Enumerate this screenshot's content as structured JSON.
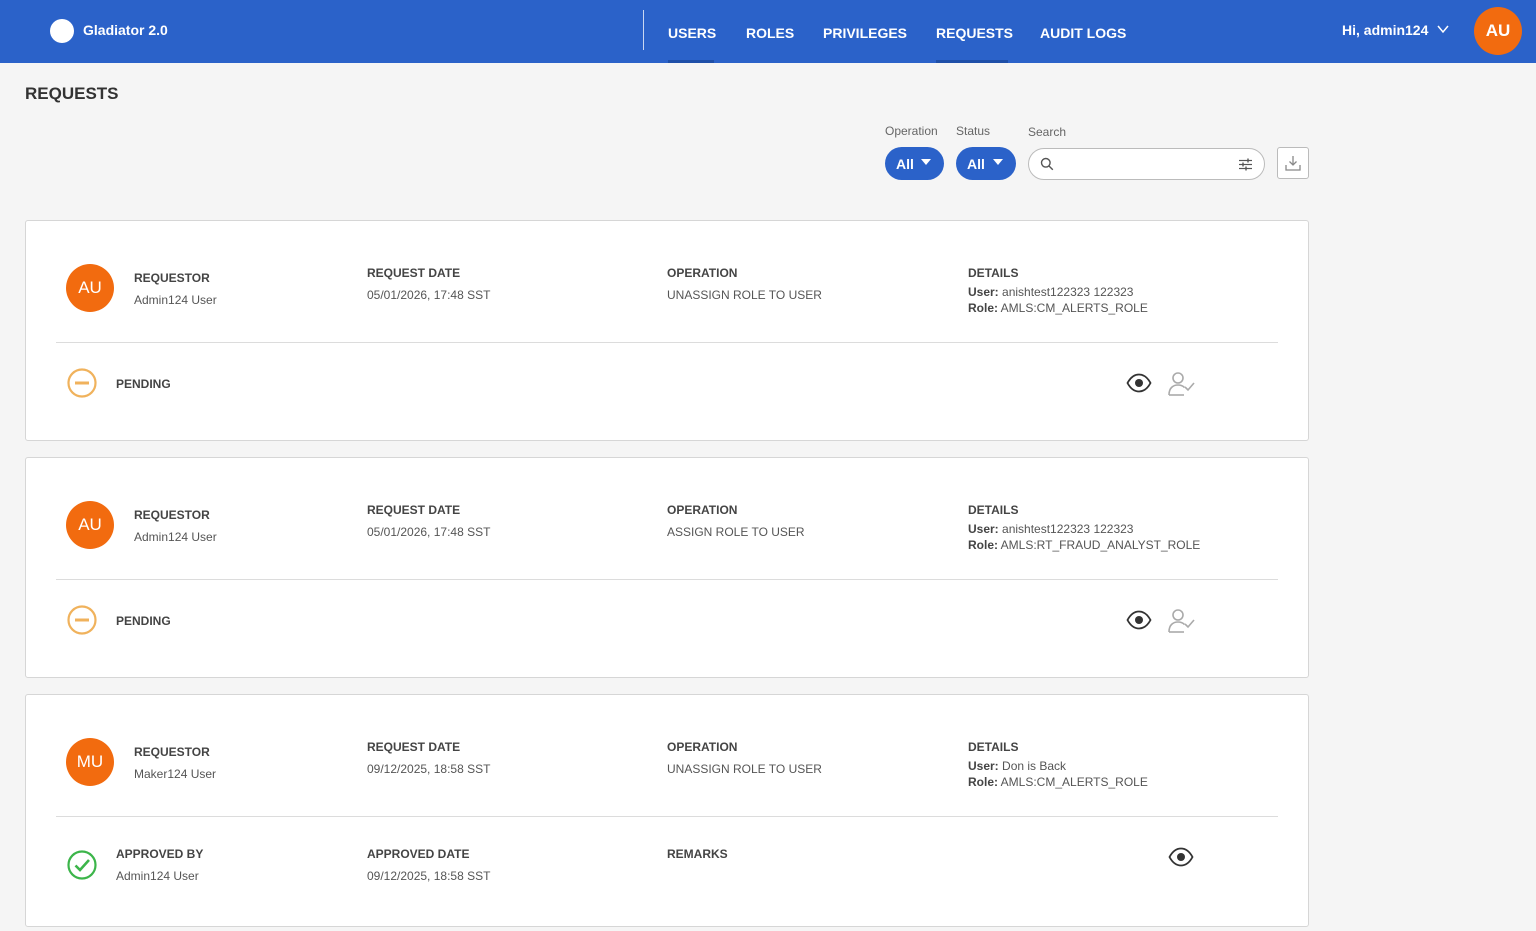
{
  "header": {
    "app_title": "Gladiator 2.0",
    "nav": [
      {
        "label": "USERS",
        "active": true
      },
      {
        "label": "ROLES",
        "active": false
      },
      {
        "label": "PRIVILEGES",
        "active": false
      },
      {
        "label": "REQUESTS",
        "active": true
      },
      {
        "label": "AUDIT LOGS",
        "active": false
      }
    ],
    "greeting": "Hi, admin124",
    "avatar_initials": "AU",
    "colors": {
      "bar": "#2b62c9",
      "avatar": "#f26b0f"
    }
  },
  "page": {
    "title": "REQUESTS"
  },
  "filters": {
    "operation": {
      "label": "Operation",
      "value": "All"
    },
    "status": {
      "label": "Status",
      "value": "All"
    },
    "search": {
      "label": "Search",
      "value": "",
      "placeholder": ""
    },
    "icons": {
      "search": "search-icon",
      "filter": "sliders-icon",
      "download": "download-icon"
    }
  },
  "requests": [
    {
      "initials": "AU",
      "requestor_label": "REQUESTOR",
      "requestor": "Admin124 User",
      "date_label": "REQUEST DATE",
      "date": "05/01/2026, 17:48 SST",
      "operation_label": "OPERATION",
      "operation": "UNASSIGN ROLE TO USER",
      "details_label": "DETAILS",
      "details_user_key": "User:",
      "details_user": "anishtest122323 122323",
      "details_role_key": "Role:",
      "details_role": "AMLS:CM_ALERTS_ROLE",
      "status": "PENDING",
      "actions": [
        "eye-icon",
        "user-check-icon"
      ]
    },
    {
      "initials": "AU",
      "requestor_label": "REQUESTOR",
      "requestor": "Admin124 User",
      "date_label": "REQUEST DATE",
      "date": "05/01/2026, 17:48 SST",
      "operation_label": "OPERATION",
      "operation": "ASSIGN ROLE TO USER",
      "details_label": "DETAILS",
      "details_user_key": "User:",
      "details_user": "anishtest122323 122323",
      "details_role_key": "Role:",
      "details_role": "AMLS:RT_FRAUD_ANALYST_ROLE",
      "status": "PENDING",
      "actions": [
        "eye-icon",
        "user-check-icon"
      ]
    },
    {
      "initials": "MU",
      "requestor_label": "REQUESTOR",
      "requestor": "Maker124 User",
      "date_label": "REQUEST DATE",
      "date": "09/12/2025, 18:58 SST",
      "operation_label": "OPERATION",
      "operation": "UNASSIGN ROLE TO USER",
      "details_label": "DETAILS",
      "details_user_key": "User:",
      "details_user": "Don is Back",
      "details_role_key": "Role:",
      "details_role": "AMLS:CM_ALERTS_ROLE",
      "approved_by_label": "APPROVED BY",
      "approved_by": "Admin124 User",
      "approved_date_label": "APPROVED DATE",
      "approved_date": "09/12/2025, 18:58 SST",
      "remarks_label": "REMARKS",
      "actions": [
        "eye-icon"
      ]
    }
  ],
  "status_colors": {
    "pending": "#f0b25c",
    "approved": "#3cb54a"
  }
}
